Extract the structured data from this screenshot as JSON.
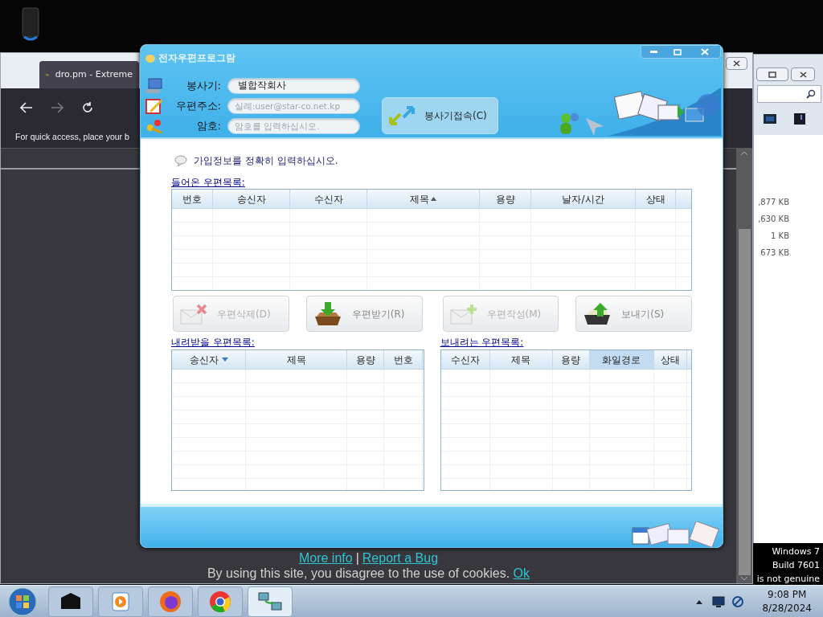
{
  "browser": {
    "tab_title": "dro.pm - Extreme",
    "bookmark_hint": "For quick access, place your b",
    "footer_links": [
      "More info",
      "Report a Bug"
    ],
    "footer_separator": "|",
    "cookie_text": "By using this site, you disagree to the use of cookies.",
    "cookie_link": "Ok"
  },
  "explorer": {
    "sizes": [
      ",877 KB",
      ",630 KB",
      "1 KB",
      "673 KB"
    ]
  },
  "app": {
    "title": "전자우편프로그람",
    "fields": [
      {
        "kind": "value",
        "label": "봉사기:",
        "value": "별합작회사"
      },
      {
        "kind": "placeholder",
        "label": "우편주소:",
        "placeholder": "실례:user@star-co.net.kp"
      },
      {
        "kind": "password",
        "label": "암호:",
        "placeholder": "암호를 입력하십시오."
      }
    ],
    "connect_button": "봉사기접속(C)",
    "hint": "가입정보를 정확히 입력하십시오.",
    "inbox": {
      "label": "들어온 우편목록:",
      "columns": [
        {
          "label": "번호",
          "sort_up": false,
          "sort_down": false
        },
        {
          "label": "송신자",
          "sort_up": false,
          "sort_down": false
        },
        {
          "label": "수신자",
          "sort_up": false,
          "sort_down": false
        },
        {
          "label": "제목",
          "sort_up": true,
          "sort_down": false
        },
        {
          "label": "용량",
          "sort_up": false,
          "sort_down": false
        },
        {
          "label": "날자/시간",
          "sort_up": false,
          "sort_down": false
        },
        {
          "label": "상태",
          "sort_up": false,
          "sort_down": false
        }
      ]
    },
    "buttons": [
      {
        "kind": "delete",
        "label": "우편삭제(D)",
        "disabled": true
      },
      {
        "kind": "receive",
        "label": "우편받기(R)",
        "disabled": false
      },
      {
        "kind": "compose",
        "label": "우편작성(M)",
        "disabled": true
      },
      {
        "kind": "send",
        "label": "보내기(S)",
        "disabled": false
      }
    ],
    "download_list": {
      "label": "내려받을 우편목록:",
      "columns": [
        {
          "label": "송신자",
          "sort_up": false,
          "sort_down": true
        },
        {
          "label": "제목",
          "sort_up": false,
          "sort_down": false
        },
        {
          "label": "용량",
          "sort_up": false,
          "sort_down": false
        },
        {
          "label": "번호",
          "sort_up": false,
          "sort_down": false
        }
      ]
    },
    "send_list": {
      "label": "보내려는 우편목록:",
      "columns": [
        {
          "label": "수신자",
          "selected": false
        },
        {
          "label": "제목",
          "selected": false
        },
        {
          "label": "용량",
          "selected": false
        },
        {
          "label": "화일경로",
          "selected": true
        },
        {
          "label": "상태",
          "selected": false
        }
      ]
    }
  },
  "watermark": [
    "Windows 7",
    "Build 7601",
    "is not genuine"
  ],
  "taskbar": {
    "time": "9:08 PM",
    "date": "8/28/2024"
  }
}
